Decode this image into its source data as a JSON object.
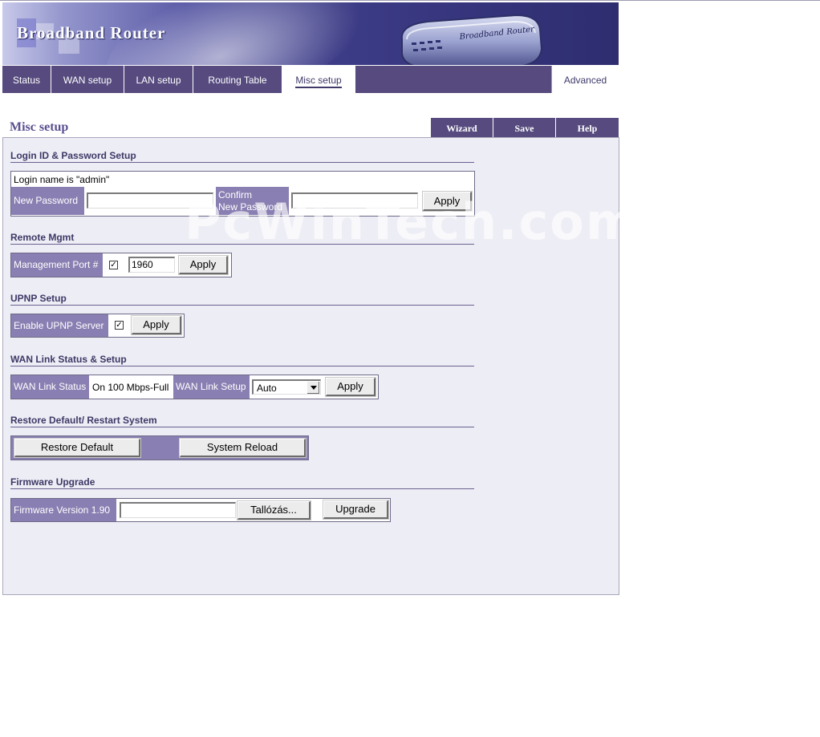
{
  "banner": {
    "title": "Broadband Router"
  },
  "nav": {
    "tabs": [
      {
        "label": "Status",
        "active": false
      },
      {
        "label": "WAN setup",
        "active": false
      },
      {
        "label": "LAN setup",
        "active": false
      },
      {
        "label": "Routing Table",
        "active": false
      },
      {
        "label": "Misc setup",
        "active": true
      }
    ],
    "advanced": "Advanced"
  },
  "page": {
    "title": "Misc setup"
  },
  "actions": {
    "wizard": "Wizard",
    "save": "Save",
    "help": "Help"
  },
  "watermark": "PcWinTech.com",
  "login": {
    "section": "Login ID & Password Setup",
    "login_name": "Login name is \"admin\"",
    "new_password_label": "New Password",
    "confirm_label_1": "Confirm",
    "confirm_label_2": "New Password",
    "new_password_value": "",
    "confirm_value": "",
    "apply": "Apply"
  },
  "remote": {
    "section": "Remote Mgmt",
    "port_label": "Management Port #",
    "enabled": true,
    "port_value": "1960",
    "apply": "Apply"
  },
  "upnp": {
    "section": "UPNP Setup",
    "label": "Enable UPNP Server",
    "enabled": true,
    "apply": "Apply"
  },
  "wan": {
    "section": "WAN Link Status & Setup",
    "status_label": "WAN Link Status",
    "status_value": "On 100 Mbps-Full",
    "setup_label": "WAN Link Setup",
    "setup_value": "Auto",
    "apply": "Apply"
  },
  "restore": {
    "section": "Restore Default/ Restart System",
    "restore_button": "Restore Default",
    "reload_button": "System Reload"
  },
  "firmware": {
    "section": "Firmware Upgrade",
    "version_label": "Firmware Version 1.90",
    "file_value": "",
    "browse_button": "Tallózás...",
    "upgrade_button": "Upgrade"
  },
  "colors": {
    "nav_bg": "#564a7e",
    "label_bg": "#8a7fb2",
    "panel_bg": "#ededf5",
    "title_color": "#5a5090"
  }
}
